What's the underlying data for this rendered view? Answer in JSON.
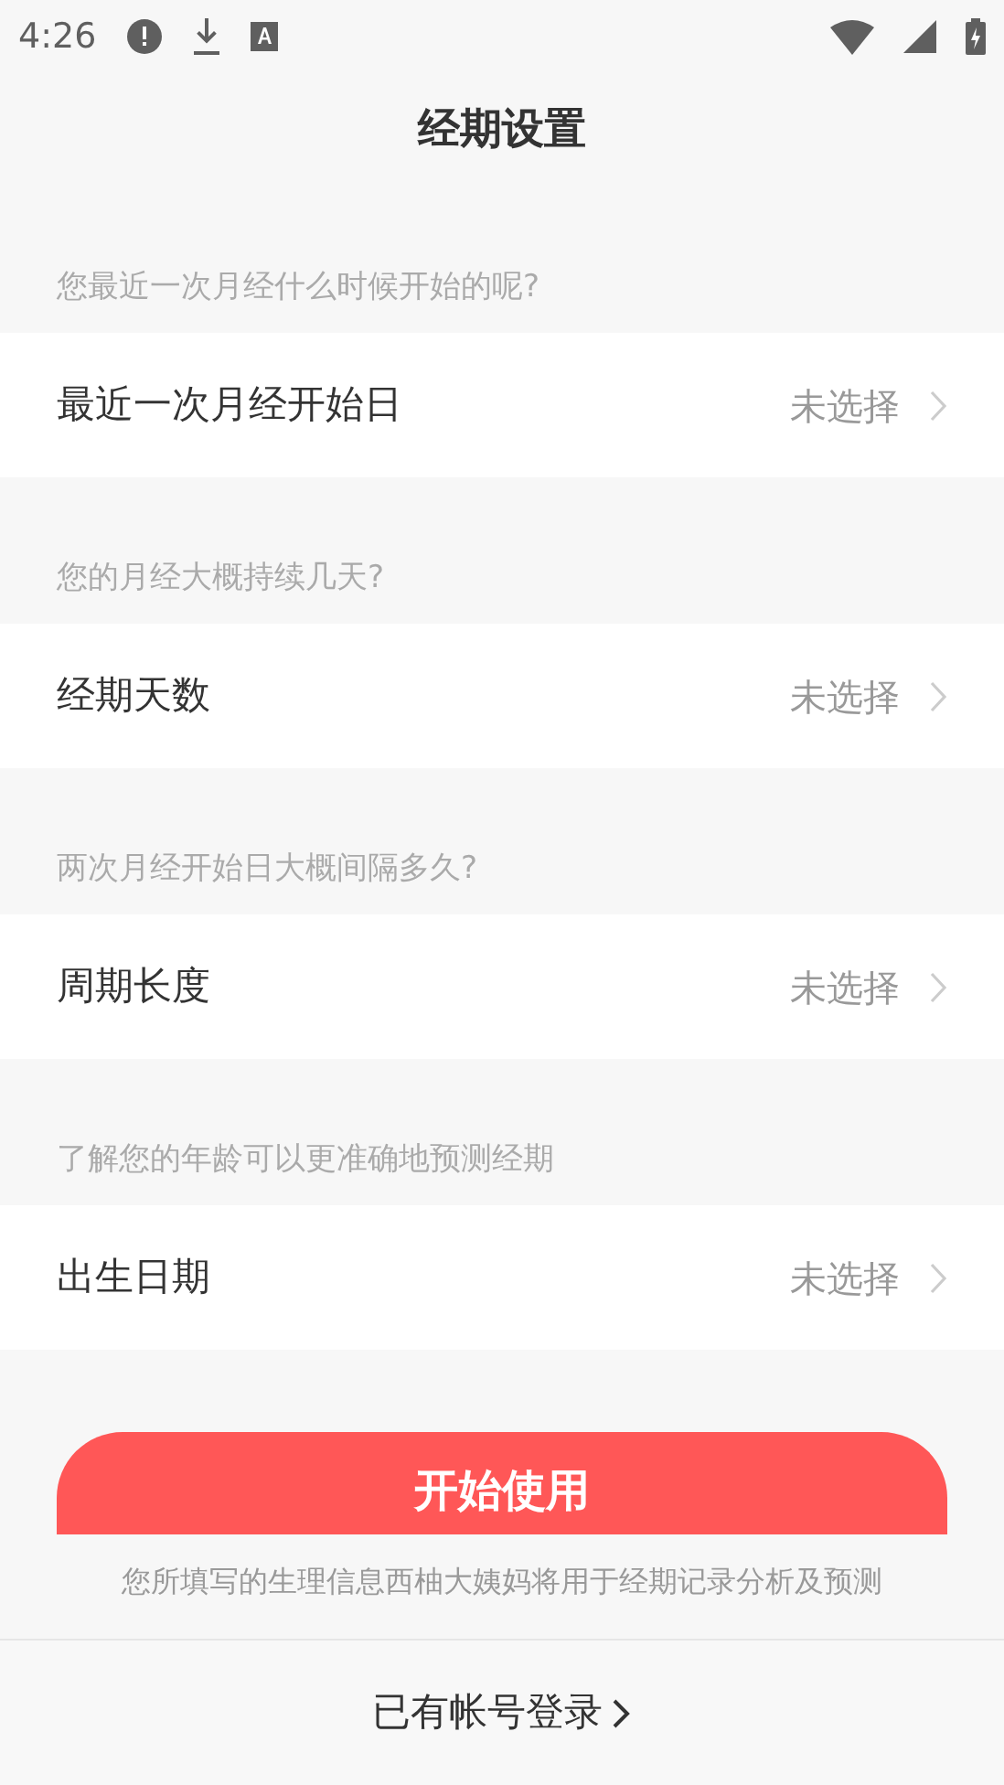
{
  "status_bar": {
    "time": "4:26"
  },
  "title": "经期设置",
  "sections": [
    {
      "hint": "您最近一次月经什么时候开始的呢?",
      "label": "最近一次月经开始日",
      "value": "未选择"
    },
    {
      "hint": "您的月经大概持续几天?",
      "label": "经期天数",
      "value": "未选择"
    },
    {
      "hint": "两次月经开始日大概间隔多久?",
      "label": "周期长度",
      "value": "未选择"
    },
    {
      "hint": "了解您的年龄可以更准确地预测经期",
      "label": "出生日期",
      "value": "未选择"
    }
  ],
  "start_button": "开始使用",
  "disclaimer": "您所填写的生理信息西柚大姨妈将用于经期记录分析及预测",
  "login_link": "已有帐号登录"
}
